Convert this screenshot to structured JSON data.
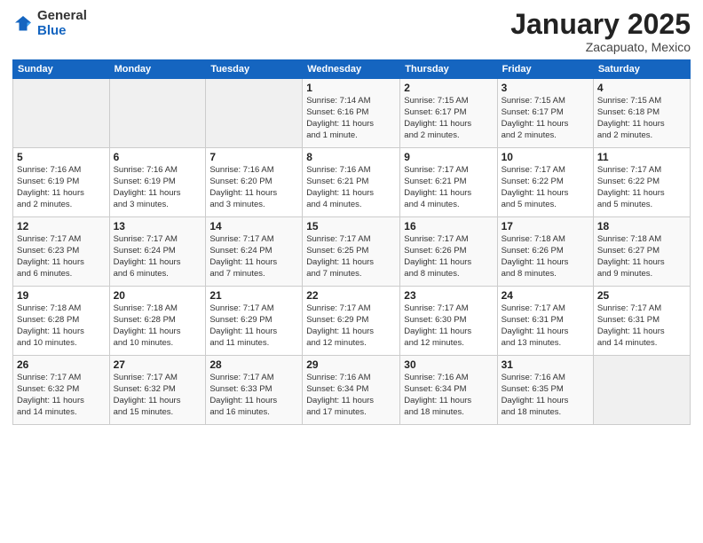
{
  "logo": {
    "general": "General",
    "blue": "Blue"
  },
  "title": "January 2025",
  "subtitle": "Zacapuato, Mexico",
  "days_header": [
    "Sunday",
    "Monday",
    "Tuesday",
    "Wednesday",
    "Thursday",
    "Friday",
    "Saturday"
  ],
  "weeks": [
    [
      {
        "day": "",
        "info": ""
      },
      {
        "day": "",
        "info": ""
      },
      {
        "day": "",
        "info": ""
      },
      {
        "day": "1",
        "info": "Sunrise: 7:14 AM\nSunset: 6:16 PM\nDaylight: 11 hours\nand 1 minute."
      },
      {
        "day": "2",
        "info": "Sunrise: 7:15 AM\nSunset: 6:17 PM\nDaylight: 11 hours\nand 2 minutes."
      },
      {
        "day": "3",
        "info": "Sunrise: 7:15 AM\nSunset: 6:17 PM\nDaylight: 11 hours\nand 2 minutes."
      },
      {
        "day": "4",
        "info": "Sunrise: 7:15 AM\nSunset: 6:18 PM\nDaylight: 11 hours\nand 2 minutes."
      }
    ],
    [
      {
        "day": "5",
        "info": "Sunrise: 7:16 AM\nSunset: 6:19 PM\nDaylight: 11 hours\nand 2 minutes."
      },
      {
        "day": "6",
        "info": "Sunrise: 7:16 AM\nSunset: 6:19 PM\nDaylight: 11 hours\nand 3 minutes."
      },
      {
        "day": "7",
        "info": "Sunrise: 7:16 AM\nSunset: 6:20 PM\nDaylight: 11 hours\nand 3 minutes."
      },
      {
        "day": "8",
        "info": "Sunrise: 7:16 AM\nSunset: 6:21 PM\nDaylight: 11 hours\nand 4 minutes."
      },
      {
        "day": "9",
        "info": "Sunrise: 7:17 AM\nSunset: 6:21 PM\nDaylight: 11 hours\nand 4 minutes."
      },
      {
        "day": "10",
        "info": "Sunrise: 7:17 AM\nSunset: 6:22 PM\nDaylight: 11 hours\nand 5 minutes."
      },
      {
        "day": "11",
        "info": "Sunrise: 7:17 AM\nSunset: 6:22 PM\nDaylight: 11 hours\nand 5 minutes."
      }
    ],
    [
      {
        "day": "12",
        "info": "Sunrise: 7:17 AM\nSunset: 6:23 PM\nDaylight: 11 hours\nand 6 minutes."
      },
      {
        "day": "13",
        "info": "Sunrise: 7:17 AM\nSunset: 6:24 PM\nDaylight: 11 hours\nand 6 minutes."
      },
      {
        "day": "14",
        "info": "Sunrise: 7:17 AM\nSunset: 6:24 PM\nDaylight: 11 hours\nand 7 minutes."
      },
      {
        "day": "15",
        "info": "Sunrise: 7:17 AM\nSunset: 6:25 PM\nDaylight: 11 hours\nand 7 minutes."
      },
      {
        "day": "16",
        "info": "Sunrise: 7:17 AM\nSunset: 6:26 PM\nDaylight: 11 hours\nand 8 minutes."
      },
      {
        "day": "17",
        "info": "Sunrise: 7:18 AM\nSunset: 6:26 PM\nDaylight: 11 hours\nand 8 minutes."
      },
      {
        "day": "18",
        "info": "Sunrise: 7:18 AM\nSunset: 6:27 PM\nDaylight: 11 hours\nand 9 minutes."
      }
    ],
    [
      {
        "day": "19",
        "info": "Sunrise: 7:18 AM\nSunset: 6:28 PM\nDaylight: 11 hours\nand 10 minutes."
      },
      {
        "day": "20",
        "info": "Sunrise: 7:18 AM\nSunset: 6:28 PM\nDaylight: 11 hours\nand 10 minutes."
      },
      {
        "day": "21",
        "info": "Sunrise: 7:17 AM\nSunset: 6:29 PM\nDaylight: 11 hours\nand 11 minutes."
      },
      {
        "day": "22",
        "info": "Sunrise: 7:17 AM\nSunset: 6:29 PM\nDaylight: 11 hours\nand 12 minutes."
      },
      {
        "day": "23",
        "info": "Sunrise: 7:17 AM\nSunset: 6:30 PM\nDaylight: 11 hours\nand 12 minutes."
      },
      {
        "day": "24",
        "info": "Sunrise: 7:17 AM\nSunset: 6:31 PM\nDaylight: 11 hours\nand 13 minutes."
      },
      {
        "day": "25",
        "info": "Sunrise: 7:17 AM\nSunset: 6:31 PM\nDaylight: 11 hours\nand 14 minutes."
      }
    ],
    [
      {
        "day": "26",
        "info": "Sunrise: 7:17 AM\nSunset: 6:32 PM\nDaylight: 11 hours\nand 14 minutes."
      },
      {
        "day": "27",
        "info": "Sunrise: 7:17 AM\nSunset: 6:32 PM\nDaylight: 11 hours\nand 15 minutes."
      },
      {
        "day": "28",
        "info": "Sunrise: 7:17 AM\nSunset: 6:33 PM\nDaylight: 11 hours\nand 16 minutes."
      },
      {
        "day": "29",
        "info": "Sunrise: 7:16 AM\nSunset: 6:34 PM\nDaylight: 11 hours\nand 17 minutes."
      },
      {
        "day": "30",
        "info": "Sunrise: 7:16 AM\nSunset: 6:34 PM\nDaylight: 11 hours\nand 18 minutes."
      },
      {
        "day": "31",
        "info": "Sunrise: 7:16 AM\nSunset: 6:35 PM\nDaylight: 11 hours\nand 18 minutes."
      },
      {
        "day": "",
        "info": ""
      }
    ]
  ]
}
